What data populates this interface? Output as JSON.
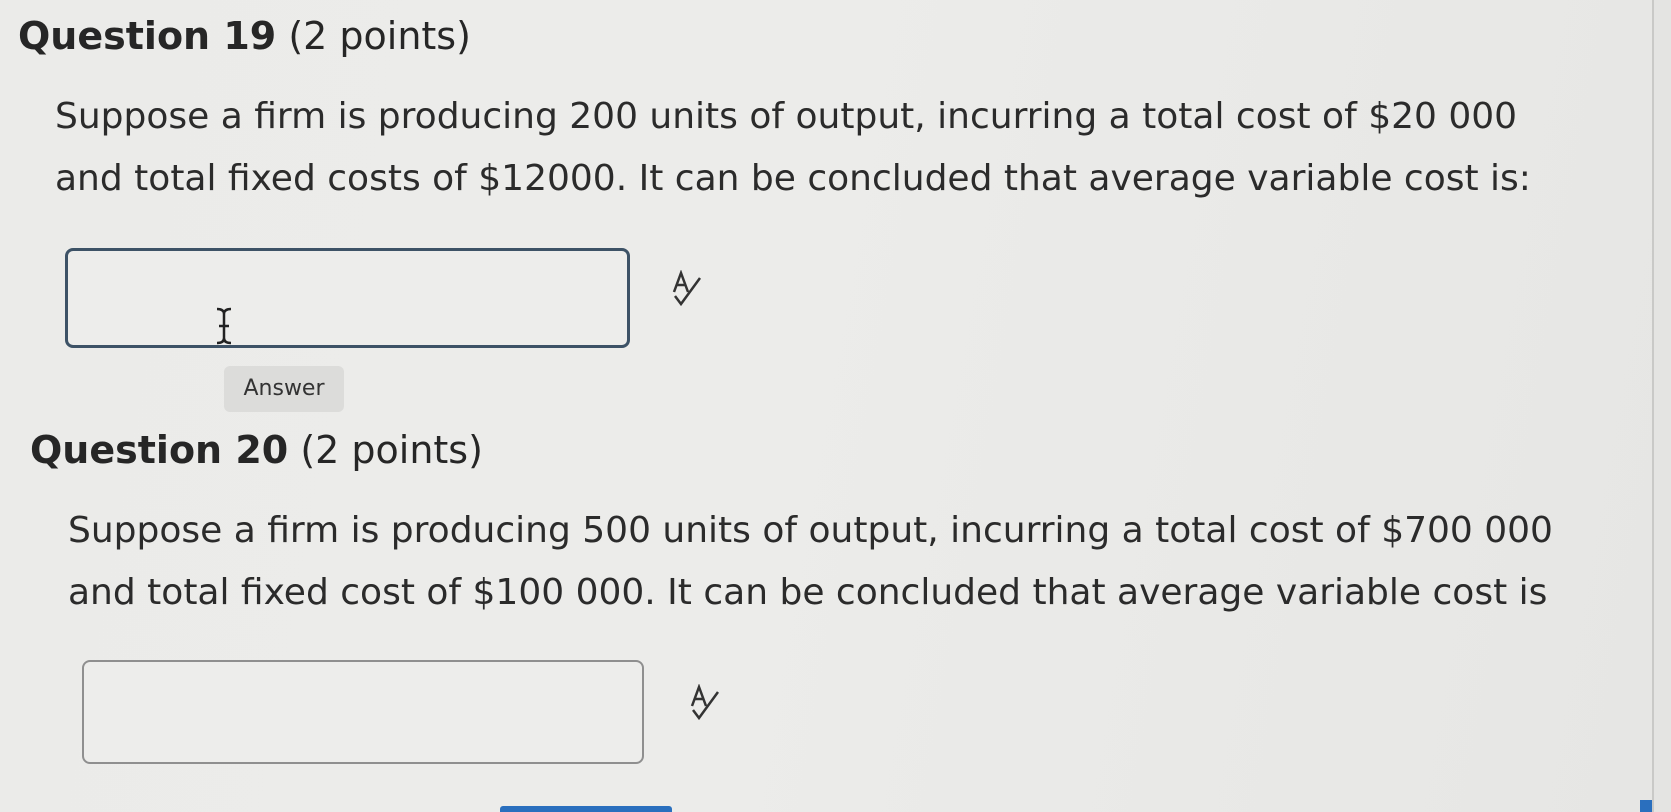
{
  "questions": [
    {
      "number_label": "Question 19",
      "points_label": "(2 points)",
      "text_line1": "Suppose a firm is producing 200 units of output, incurring a total cost of $20 000",
      "text_line2": "and total fixed costs of $12000. It can be concluded that average variable cost is:",
      "answer_value": "",
      "tooltip": "Answer",
      "spellcheck_icon": "spellcheck-icon"
    },
    {
      "number_label": "Question 20",
      "points_label": "(2 points)",
      "text_line1": "Suppose a firm is producing 500 units of output, incurring a total cost of $700 000",
      "text_line2": "and total fixed cost of $100 000. It can be concluded that average variable cost is",
      "answer_value": "",
      "spellcheck_icon": "spellcheck-icon"
    }
  ],
  "colors": {
    "focused_border": "#3d5266",
    "accent": "#2a6fbe"
  }
}
